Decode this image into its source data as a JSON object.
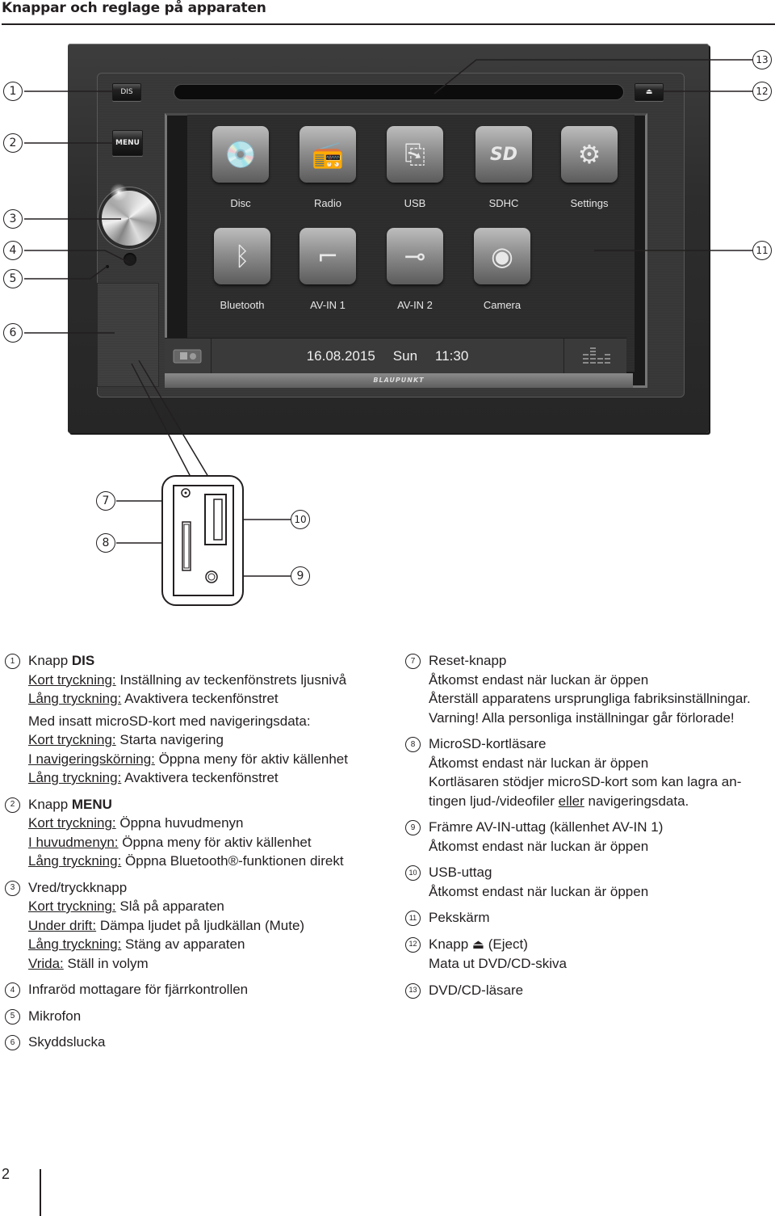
{
  "page": {
    "title": "Knappar och reglage på apparaten",
    "page_number": "2"
  },
  "device": {
    "dis_label": "DIS",
    "menu_label": "MENU",
    "eject_symbol": "⏏",
    "brand": "BLAUPUNKT",
    "apps": [
      {
        "label": "Disc",
        "icon": "disc-icon",
        "glyph": "💿"
      },
      {
        "label": "Radio",
        "icon": "radio-icon",
        "glyph": "📻"
      },
      {
        "label": "USB",
        "icon": "usb-icon",
        "glyph": "⎘"
      },
      {
        "label": "SDHC",
        "icon": "sd-card-icon",
        "glyph": "SD"
      },
      {
        "label": "Settings",
        "icon": "gear-icon",
        "glyph": "⚙"
      },
      {
        "label": "Bluetooth",
        "icon": "bluetooth-icon",
        "glyph": "ᛒ"
      },
      {
        "label": "AV-IN 1",
        "icon": "audio-jack-icon",
        "glyph": "⌐"
      },
      {
        "label": "AV-IN 2",
        "icon": "rca-plug-icon",
        "glyph": "⊸"
      },
      {
        "label": "Camera",
        "icon": "camera-icon",
        "glyph": "◉"
      }
    ],
    "status_bar": {
      "date": "16.08.2015",
      "day": "Sun",
      "time": "11:30"
    }
  },
  "callouts": [
    "1",
    "2",
    "3",
    "4",
    "5",
    "6",
    "7",
    "8",
    "9",
    "10",
    "11",
    "12",
    "13"
  ],
  "legend": {
    "left": [
      {
        "num": "1",
        "title_prefix": "Knapp ",
        "title_bold": "DIS",
        "lines": [
          {
            "label": "Kort tryckning:",
            "text": " Inställning av teckenfönstrets ljusnivå"
          },
          {
            "label": "Lång tryckning:",
            "text": " Avaktivera teckenfönstret"
          }
        ],
        "subheading": "Med insatt microSD-kort med navigeringsdata:",
        "lines2": [
          {
            "label": "Kort tryckning:",
            "text": " Starta navigering"
          },
          {
            "label": "I navigeringskörning:",
            "text": " Öppna meny för aktiv källenhet"
          },
          {
            "label": "Lång tryckning:",
            "text": " Avaktivera teckenfönstret"
          }
        ]
      },
      {
        "num": "2",
        "title_prefix": "Knapp ",
        "title_bold": "MENU",
        "lines": [
          {
            "label": "Kort tryckning:",
            "text": " Öppna huvudmenyn"
          },
          {
            "label": "I huvudmenyn:",
            "text": " Öppna meny för aktiv källenhet"
          },
          {
            "label": "Lång tryckning:",
            "text": " Öppna Bluetooth®-funktionen direkt"
          }
        ]
      },
      {
        "num": "3",
        "title": "Vred/tryckknapp",
        "lines": [
          {
            "label": "Kort tryckning:",
            "text": " Slå på apparaten"
          },
          {
            "label": "Under drift:",
            "text": " Dämpa ljudet på ljudkällan (Mute)"
          },
          {
            "label": "Lång tryckning:",
            "text": " Stäng av apparaten"
          },
          {
            "label": "Vrida:",
            "text": " Ställ in volym"
          }
        ]
      },
      {
        "num": "4",
        "title": "Infraröd mottagare för fjärrkontrollen"
      },
      {
        "num": "5",
        "title": "Mikrofon"
      },
      {
        "num": "6",
        "title": "Skyddslucka"
      }
    ],
    "right": [
      {
        "num": "7",
        "title": "Reset-knapp",
        "plain": [
          "Åtkomst endast när luckan är öppen",
          "Återställ apparatens ursprungliga fabriksinställningar.",
          "Varning! Alla personliga inställningar går förlorade!"
        ]
      },
      {
        "num": "8",
        "title": "MicroSD-kortläsare",
        "plain": [
          "Åtkomst endast när luckan är öppen",
          "Kortläsaren stödjer microSD-kort som kan lagra an-"
        ],
        "last_prefix": "tingen ljud-/videofiler ",
        "last_underline": "eller",
        "last_suffix": " navigeringsdata."
      },
      {
        "num": "9",
        "title": "Främre AV-IN-uttag (källenhet AV-IN 1)",
        "plain": [
          "Åtkomst endast när luckan är öppen"
        ]
      },
      {
        "num": "10",
        "title": "USB-uttag",
        "plain": [
          "Åtkomst endast när luckan är öppen"
        ]
      },
      {
        "num": "11",
        "title": "Pekskärm"
      },
      {
        "num": "12",
        "title_prefix": "Knapp ",
        "eject": "⏏",
        "title_suffix": " (Eject)",
        "plain": [
          "Mata ut DVD/CD-skiva"
        ]
      },
      {
        "num": "13",
        "title": "DVD/CD-läsare"
      }
    ]
  }
}
